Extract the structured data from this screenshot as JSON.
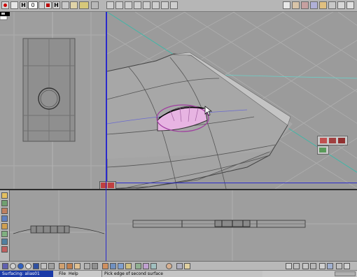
{
  "toolbar": {
    "hotkey_h1": "H",
    "field_value": "0",
    "hotkey_h2": "H"
  },
  "status_bar": {
    "window_label": "Surfacing: alias01",
    "menu_file": "File",
    "menu_help": "Help",
    "prompt_text": "Pick edge of second surface"
  },
  "colors": {
    "background": "#9e9e9e",
    "grid": "#b2b2b2",
    "active_border": "#2a2acc",
    "hole_surface": "#e4b2e0",
    "highlight_edge": "#a03ca0"
  },
  "icons": {
    "toolbar_left": [
      "red-dot-icon",
      "h-icon",
      "field-icon",
      "stepper-icon",
      "stop-icon",
      "h-icon",
      "arrow-icon",
      "pencil-icon",
      "layer-icon"
    ],
    "toolbar_mid": [
      "move-icon",
      "rotate-icon",
      "scale-icon",
      "zoom-icon",
      "pan-icon",
      "tumble-icon",
      "lasso-icon"
    ],
    "toolbar_right": [
      "doc-icon",
      "layers-icon",
      "render-icon",
      "camera-icon",
      "light-icon",
      "book-icon",
      "help-icon"
    ],
    "left_palette": [
      "curve-icon",
      "surface-icon",
      "trim-icon",
      "loft-icon",
      "fillet-icon",
      "draft-icon",
      "blend-icon",
      "check-icon"
    ],
    "bottom_shelf": [
      "sphere-icon",
      "sphere-icon",
      "cylinder-icon",
      "torus-icon",
      "cone-icon",
      "cube-icon",
      "plane-icon",
      "person-icon",
      "light-icon",
      "camera-icon"
    ]
  }
}
